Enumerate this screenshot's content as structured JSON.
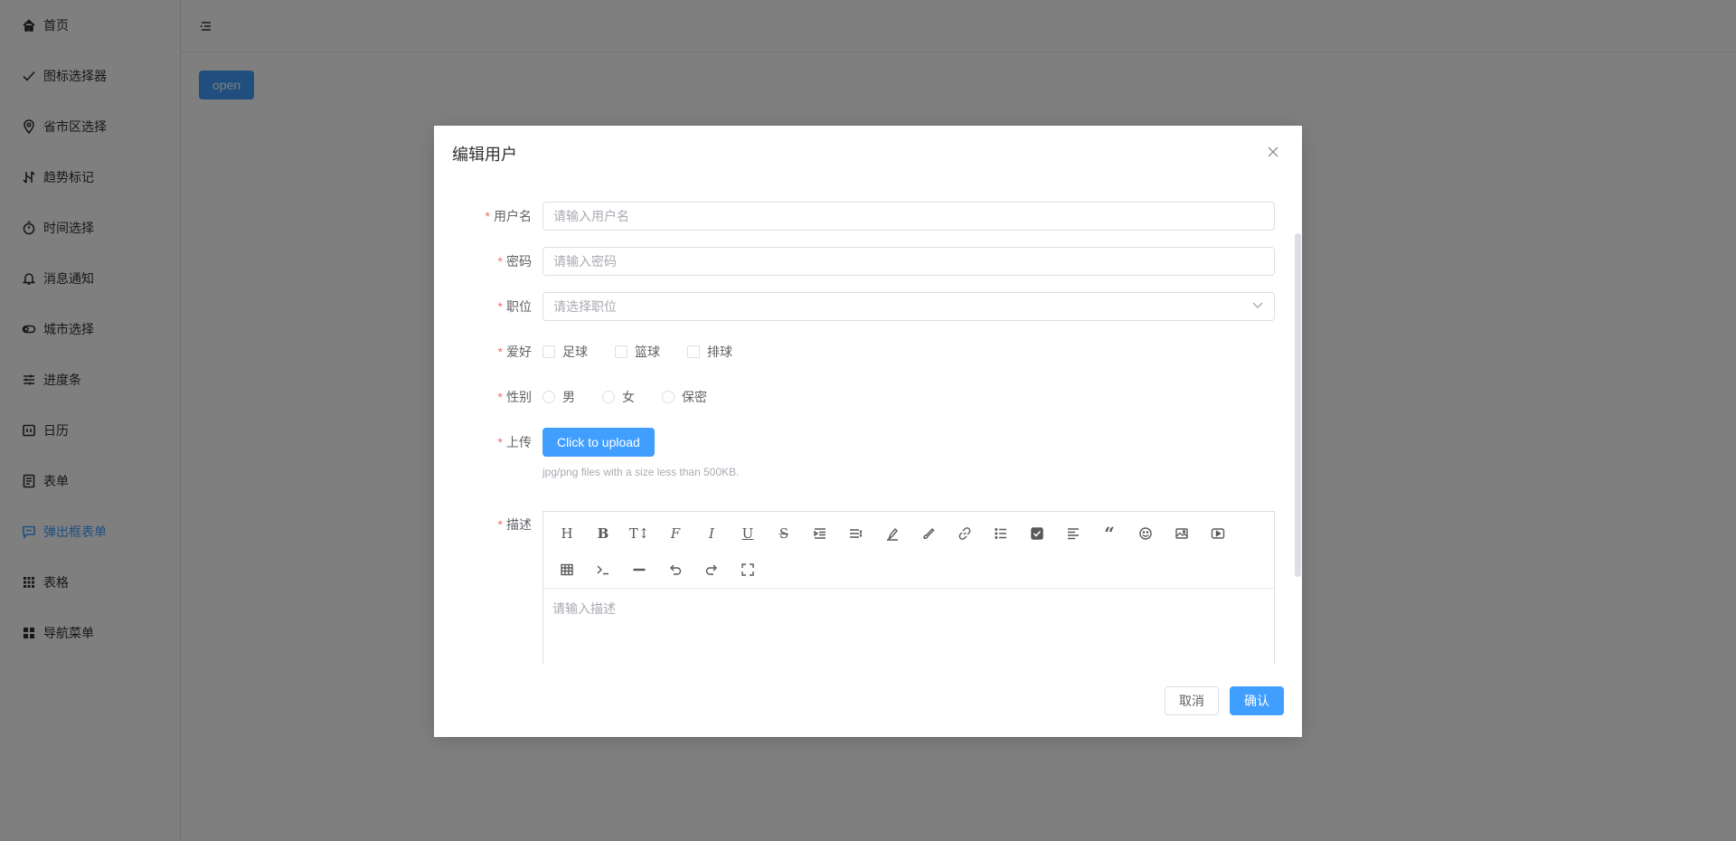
{
  "sidebar": {
    "items": [
      {
        "label": "首页",
        "icon": "home-icon"
      },
      {
        "label": "图标选择器",
        "icon": "check-icon"
      },
      {
        "label": "省市区选择",
        "icon": "location-icon"
      },
      {
        "label": "趋势标记",
        "icon": "trend-icon"
      },
      {
        "label": "时间选择",
        "icon": "timer-icon"
      },
      {
        "label": "消息通知",
        "icon": "bell-icon"
      },
      {
        "label": "城市选择",
        "icon": "toggle-icon"
      },
      {
        "label": "进度条",
        "icon": "sliders-icon"
      },
      {
        "label": "日历",
        "icon": "calendar-icon"
      },
      {
        "label": "表单",
        "icon": "document-icon"
      },
      {
        "label": "弹出框表单",
        "icon": "chat-icon",
        "active": true
      },
      {
        "label": "表格",
        "icon": "grid-icon"
      },
      {
        "label": "导航菜单",
        "icon": "menu-icon"
      }
    ]
  },
  "header": {
    "toggle_icon": "hamburger-icon"
  },
  "main": {
    "open_label": "open"
  },
  "dialog": {
    "title": "编辑用户",
    "username": {
      "label": "用户名",
      "placeholder": "请输入用户名"
    },
    "password": {
      "label": "密码",
      "placeholder": "请输入密码"
    },
    "position": {
      "label": "职位",
      "placeholder": "请选择职位"
    },
    "hobby": {
      "label": "爱好",
      "options": [
        "足球",
        "篮球",
        "排球"
      ]
    },
    "gender": {
      "label": "性别",
      "options": [
        "男",
        "女",
        "保密"
      ]
    },
    "upload": {
      "label": "上传",
      "button": "Click to upload",
      "tip": "jpg/png files with a size less than 500KB."
    },
    "description": {
      "label": "描述",
      "placeholder": "请输入描述"
    },
    "cancel_label": "取消",
    "confirm_label": "确认"
  },
  "colors": {
    "primary": "#409eff",
    "required": "#f56c6c",
    "overlay": "rgba(0,0,0,0.5)"
  }
}
